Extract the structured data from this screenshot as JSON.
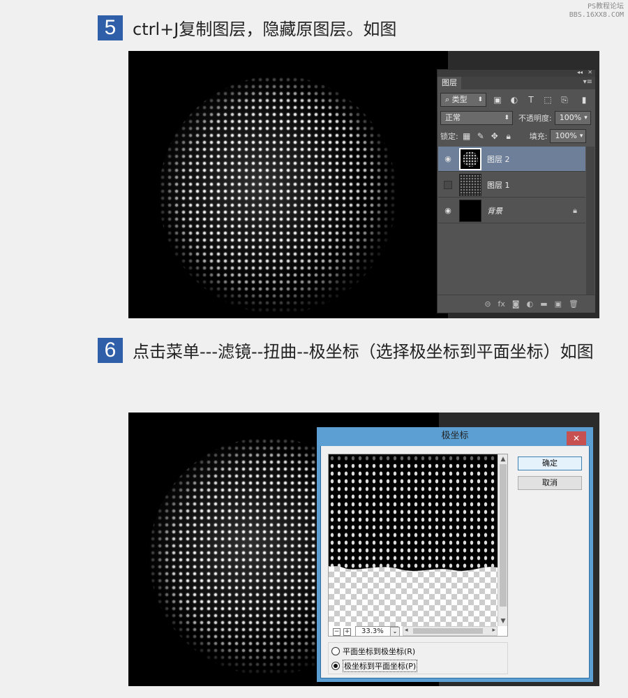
{
  "watermark": {
    "line1": "PS教程论坛",
    "line2": "BBS.16XX8.COM"
  },
  "steps": [
    {
      "number": "5",
      "text": "ctrl+J复制图层，隐藏原图层。如图"
    },
    {
      "number": "6",
      "text": "点击菜单---滤镜--扭曲--极坐标（选择极坐标到平面坐标）如图"
    }
  ],
  "layers_panel": {
    "tab": "图层",
    "filter_type": "类型",
    "blend_mode": "正常",
    "opacity_label": "不透明度:",
    "opacity_value": "100%",
    "lock_label": "锁定:",
    "fill_label": "填充:",
    "fill_value": "100%",
    "icons": {
      "collapse": "double-chevron-icon",
      "close": "close-icon",
      "menu": "panel-menu-icon"
    },
    "layers": [
      {
        "name": "图层 2",
        "selected": true,
        "visible": true
      },
      {
        "name": "图层 1",
        "selected": false,
        "visible": false
      },
      {
        "name": "背景",
        "selected": false,
        "visible": true,
        "locked": true
      }
    ],
    "bottom_icons": [
      "link-icon",
      "fx-icon",
      "mask-icon",
      "adjustment-icon",
      "folder-icon",
      "new-layer-icon",
      "trash-icon"
    ]
  },
  "polar_dialog": {
    "title": "极坐标",
    "close": "✕",
    "ok_label": "确定",
    "cancel_label": "取消",
    "zoom_value": "33.3%",
    "options": [
      {
        "label": "平面坐标到极坐标(R)",
        "selected": false
      },
      {
        "label": "极坐标到平面坐标(P)",
        "selected": true
      }
    ]
  },
  "colors": {
    "step_badge": "#2f5fa8",
    "selected_layer": "#6d7f99",
    "dialog_frame": "#5ca0d3",
    "close_button": "#c75050"
  }
}
